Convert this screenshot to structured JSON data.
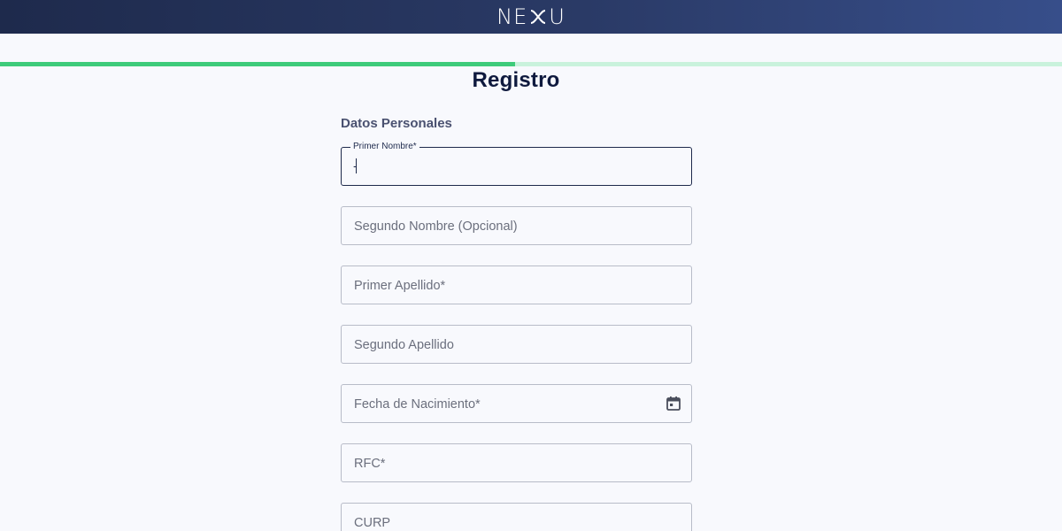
{
  "header": {
    "brand": "NEXU"
  },
  "progress": {
    "fraction": 0.485
  },
  "page": {
    "title": "Registro"
  },
  "section": {
    "label": "Datos Personales"
  },
  "fields": [
    {
      "name": "first-name",
      "label": "Primer Nombre*",
      "value": "-",
      "focused": true
    },
    {
      "name": "second-name",
      "placeholder": "Segundo Nombre (Opcional)"
    },
    {
      "name": "first-lastname",
      "placeholder": "Primer Apellido*"
    },
    {
      "name": "second-lastname",
      "placeholder": "Segundo Apellido"
    },
    {
      "name": "birthdate",
      "placeholder": "Fecha de Nacimiento*",
      "icon": "calendar-icon"
    },
    {
      "name": "rfc",
      "placeholder": "RFC*"
    },
    {
      "name": "curp",
      "placeholder": "CURP"
    }
  ],
  "colors": {
    "primary": "#1e2a4c",
    "progress": "#3ecb7a",
    "progress_track": "#c9f2dc"
  }
}
